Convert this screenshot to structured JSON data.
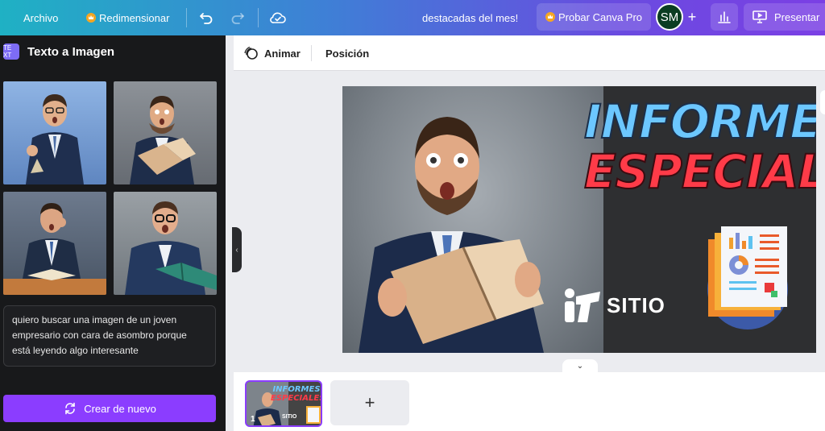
{
  "topbar": {
    "file_label": "Archivo",
    "resize_label": "Redimensionar",
    "notice_text": "destacadas del mes!",
    "pro_label": "Probar Canva Pro",
    "avatar_initials": "SM",
    "present_label": "Presentar"
  },
  "panel": {
    "title": "Texto a Imagen",
    "app_icon_text": "TE XT",
    "prompt_text": "quiero buscar una imagen de un joven empresario con cara de asombro porque está leyendo algo interesante",
    "regenerate_label": "Crear de nuevo",
    "images": [
      {
        "bg": "#6f97c9"
      },
      {
        "bg": "#7b8087"
      },
      {
        "bg": "#566170"
      },
      {
        "bg": "#7e868d"
      }
    ]
  },
  "editor_toolbar": {
    "animate_label": "Animar",
    "position_label": "Posición"
  },
  "canvas": {
    "headline_1": "INFORMES",
    "headline_2": "ESPECIALES",
    "brand_text": "SITIO",
    "colors": {
      "headline_1": "#6cc7ff",
      "headline_2": "#ff3b48",
      "accent": "#8b3dff"
    }
  },
  "pages": {
    "page_number": "1",
    "thumb_headline_1": "INFORMES",
    "thumb_headline_2": "ESPECIALES",
    "thumb_brand": "SITIO",
    "add_page_label": "+"
  },
  "icons": [
    "undo-icon",
    "redo-icon",
    "cloud-check-icon",
    "crown-icon",
    "bar-chart-icon",
    "present-icon",
    "refresh-icon",
    "animate-icon",
    "chevron-left-icon",
    "chevron-down-icon"
  ]
}
